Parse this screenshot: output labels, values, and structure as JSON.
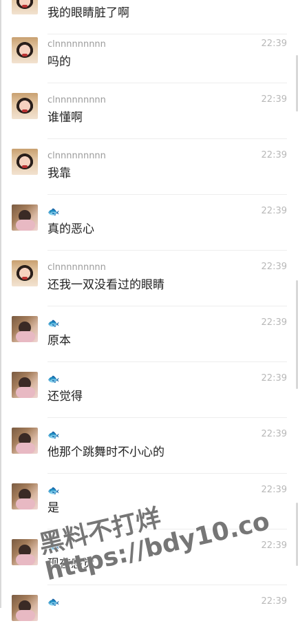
{
  "messages": [
    {
      "sender": "",
      "time": "",
      "text": "我的眼睛脏了啊",
      "avatar": "girl-avatar"
    },
    {
      "sender": "clnnnnnnnnn",
      "time": "22:39",
      "text": "吗的",
      "avatar": "girl-avatar"
    },
    {
      "sender": "clnnnnnnnnn",
      "time": "22:39",
      "text": "谁懂啊",
      "avatar": "girl-avatar"
    },
    {
      "sender": "clnnnnnnnnn",
      "time": "22:39",
      "text": "我靠",
      "avatar": "girl-avatar"
    },
    {
      "sender": "🐟",
      "time": "22:39",
      "text": "真的恶心",
      "avatar": "child-avatar"
    },
    {
      "sender": "clnnnnnnnnn",
      "time": "22:39",
      "text": "还我一双没看过的眼睛",
      "avatar": "girl-avatar"
    },
    {
      "sender": "🐟",
      "time": "22:39",
      "text": "原本",
      "avatar": "child-avatar"
    },
    {
      "sender": "🐟",
      "time": "22:39",
      "text": "还觉得",
      "avatar": "child-avatar"
    },
    {
      "sender": "🐟",
      "time": "22:39",
      "text": "他那个跳舞时不小心的",
      "avatar": "child-avatar"
    },
    {
      "sender": "🐟",
      "time": "22:39",
      "text": "是",
      "avatar": "child-avatar"
    },
    {
      "sender": "🐟",
      "time": "22:39",
      "text": "现在感觉",
      "avatar": "child-avatar"
    },
    {
      "sender": "🐟",
      "time": "22:39",
      "text": "",
      "avatar": "child-avatar"
    }
  ],
  "watermark": {
    "line1": "黑料不打烊",
    "line2": "https://bdy10.co"
  }
}
